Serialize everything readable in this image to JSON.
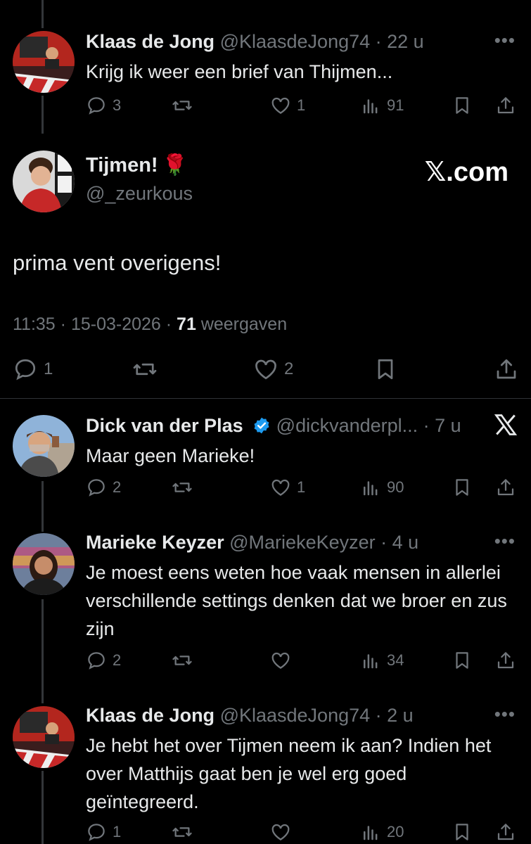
{
  "tweets_top": {
    "name": "Klaas de Jong",
    "handle": "@KlaasdeJong74",
    "time": "22 u",
    "text": "Krijg ik weer een brief van Thijmen...",
    "replies": "3",
    "retweets": "",
    "likes": "1",
    "views": "91"
  },
  "main": {
    "name": "Tijmen!",
    "emoji": "🌹",
    "handle": "@_zeurkous",
    "brand": "𝕏.com",
    "text": "prima vent overigens!",
    "time": "11:35",
    "date": "15-03-2026",
    "views_count": "71",
    "views_label": "weergaven",
    "replies": "1",
    "likes": "2"
  },
  "replies": [
    {
      "name": "Dick van der Plas",
      "handle": "@dickvanderpl...",
      "time": "7 u",
      "text": "Maar geen Marieke!",
      "replies": "2",
      "likes": "1",
      "views": "90"
    },
    {
      "name": "Marieke Keyzer",
      "handle": "@MariekeKeyzer",
      "time": "4 u",
      "text": "Je moest eens weten hoe vaak mensen in allerlei verschillende settings denken dat we broer en zus zijn",
      "replies": "2",
      "likes": "",
      "views": "34"
    },
    {
      "name": "Klaas de Jong",
      "handle": "@KlaasdeJong74",
      "time": "2 u",
      "text": "Je hebt het over Tijmen neem ik aan? Indien het over Matthijs gaat ben je wel erg goed geïntegreerd.",
      "replies": "1",
      "likes": "",
      "views": "20"
    }
  ],
  "colors": {
    "background": "#000000",
    "text": "#e7e9ea",
    "muted": "#71767b",
    "verified": "#1d9bf0"
  }
}
